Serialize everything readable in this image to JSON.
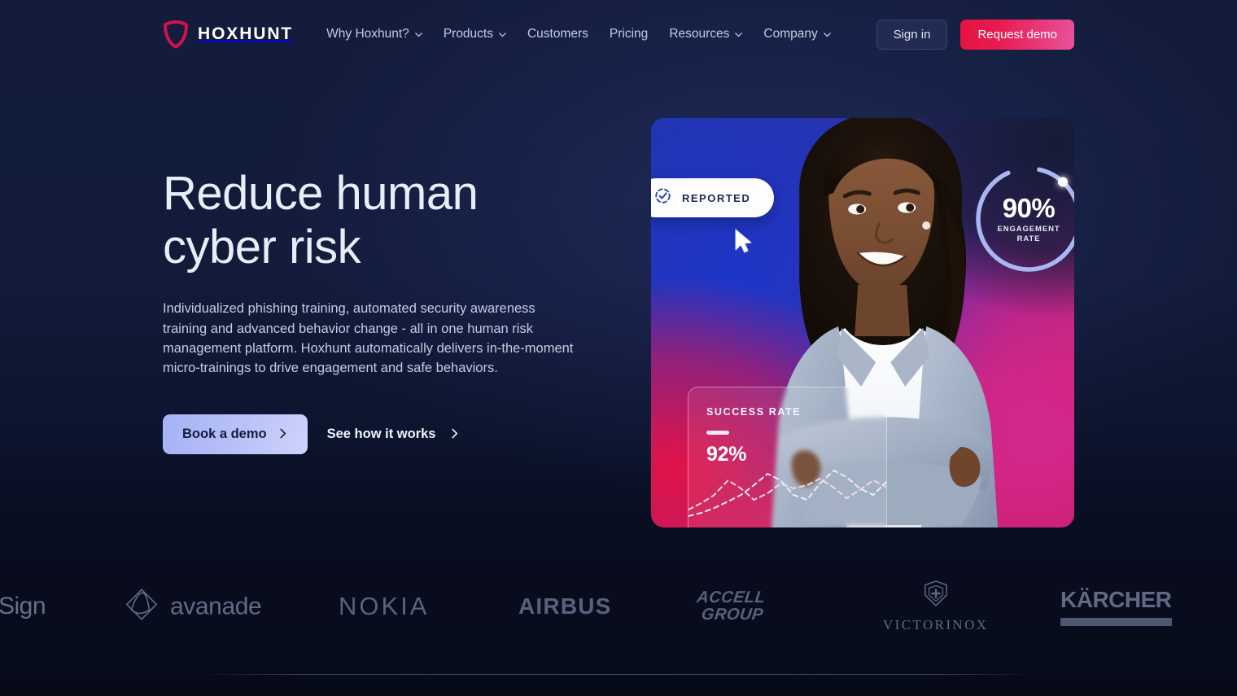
{
  "brand": {
    "name": "HOXHUNT",
    "shield_icon": "shield-icon",
    "shield_color": "#d2124a"
  },
  "nav": {
    "items": [
      {
        "label": "Why Hoxhunt?",
        "has_dropdown": true
      },
      {
        "label": "Products",
        "has_dropdown": true
      },
      {
        "label": "Customers",
        "has_dropdown": false
      },
      {
        "label": "Pricing",
        "has_dropdown": false
      },
      {
        "label": "Resources",
        "has_dropdown": true
      },
      {
        "label": "Company",
        "has_dropdown": true
      }
    ]
  },
  "header_actions": {
    "sign_in": "Sign in",
    "request_demo": "Request demo",
    "demo_gradient_from": "#e5123f",
    "demo_gradient_to": "#e8529c"
  },
  "hero": {
    "headline_line1": "Reduce human",
    "headline_line2": "cyber risk",
    "subcopy": "Individualized phishing training, automated security awareness training and advanced behavior change - all in one human risk management platform. Hoxhunt automatically delivers in-the-moment micro-trainings to drive engagement and safe behaviors.",
    "primary_cta": "Book a demo",
    "secondary_cta": "See how it works"
  },
  "hero_visual": {
    "reported_badge": {
      "label": "REPORTED",
      "icon": "check-circle-dashed-icon"
    },
    "cursor_icon": "mouse-cursor-icon",
    "engagement_ring": {
      "value": "90%",
      "label_line1": "ENGAGEMENT",
      "label_line2": "RATE",
      "percent": 90,
      "ring_color": "#aab6f2"
    },
    "success_card": {
      "label": "SUCCESS RATE",
      "value": "92%"
    }
  },
  "logos": {
    "items": [
      {
        "name": "sign",
        "text": "Sign"
      },
      {
        "name": "avanade",
        "text": "avanade"
      },
      {
        "name": "nokia",
        "text": "NOKIA"
      },
      {
        "name": "airbus",
        "text": "AIRBUS"
      },
      {
        "name": "accell-group",
        "line1": "ACCELL",
        "line2": "GROUP"
      },
      {
        "name": "victorinox",
        "text": "VICTORINOX"
      },
      {
        "name": "karcher",
        "text": "KÄRCHER"
      }
    ]
  },
  "chart_data": {
    "type": "line",
    "title": "SUCCESS RATE",
    "series": [
      {
        "name": "success-rate-line-a",
        "values": [
          18,
          26,
          35,
          58,
          44,
          30,
          40,
          55,
          48,
          52,
          60,
          47,
          33,
          44,
          58,
          50
        ]
      },
      {
        "name": "success-rate-line-b",
        "values": [
          10,
          16,
          22,
          31,
          40,
          52,
          66,
          58,
          40,
          35,
          55,
          70,
          62,
          48,
          40,
          56
        ]
      }
    ],
    "annotation": "92%",
    "xlabel": "",
    "ylabel": "",
    "grid": false,
    "legend": "none"
  }
}
